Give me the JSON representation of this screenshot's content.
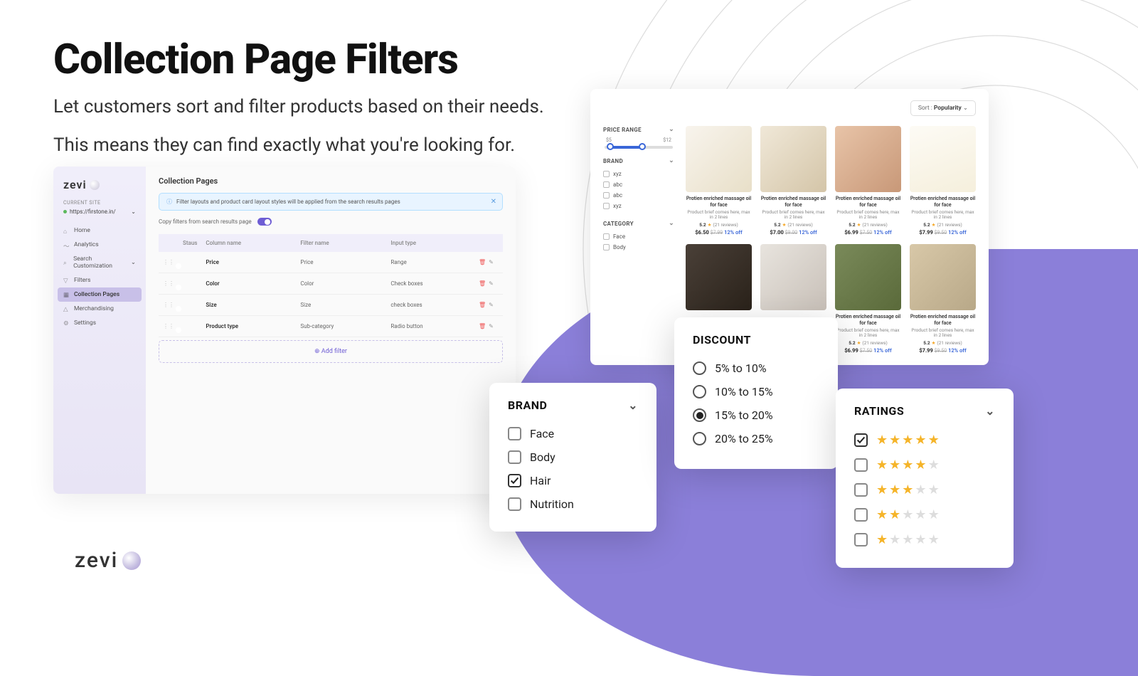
{
  "hero": {
    "title": "Collection Page Filters",
    "line1": "Let customers sort and filter products based on their needs.",
    "line2": "This means they can find exactly what you're looking for."
  },
  "admin": {
    "logo": "zevi",
    "site_label": "CURRENT SITE",
    "site_url": "https://firstone.in/",
    "nav": {
      "home": "Home",
      "analytics": "Analytics",
      "search": "Search Customization",
      "filters": "Filters",
      "collection": "Collection Pages",
      "merch": "Merchandising",
      "settings": "Settings"
    },
    "page_title": "Collection Pages",
    "banner": "Filter layouts and product card layout styles will be applied from the search results pages",
    "copy_label": "Copy filters from search results page",
    "table": {
      "h1": "Staus",
      "h2": "Column name",
      "h3": "Filter name",
      "h4": "Input type",
      "rows": [
        {
          "col": "Price",
          "filter": "Price",
          "type": "Range"
        },
        {
          "col": "Color",
          "filter": "Color",
          "type": "Check boxes"
        },
        {
          "col": "Size",
          "filter": "Size",
          "type": "check boxes"
        },
        {
          "col": "Product type",
          "filter": "Sub-category",
          "type": "Radio button"
        }
      ]
    },
    "add_filter": "Add filter"
  },
  "storefront": {
    "sort_label": "Sort : ",
    "sort_value": "Popularity",
    "filters": {
      "price": {
        "title": "PRICE RANGE",
        "low": "$5",
        "high": "$12"
      },
      "brand": {
        "title": "BRAND",
        "opts": [
          "xyz",
          "abc",
          "abc",
          "xyz"
        ]
      },
      "category": {
        "title": "CATEGORY",
        "opts": [
          "Face",
          "Body"
        ]
      }
    },
    "product": {
      "name": "Protien enriched massage oil for face",
      "brief": "Product brief comes here, max in 2 lines",
      "rating": "5.2",
      "reviews": "(21 reviews)",
      "off": "12% off"
    },
    "prices": [
      "$6.50",
      "$7.00",
      "$6.99",
      "$7.99"
    ],
    "strikes": [
      "$7.99",
      "$9.00",
      "$7.50",
      "$9.50"
    ]
  },
  "popups": {
    "brand": {
      "title": "BRAND",
      "opts": [
        "Face",
        "Body",
        "Hair",
        "Nutrition"
      ],
      "selected": 2
    },
    "discount": {
      "title": "DISCOUNT",
      "opts": [
        "5% to 10%",
        "10% to 15%",
        "15% to 20%",
        "20% to 25%"
      ],
      "selected": 2
    },
    "ratings": {
      "title": "RATINGS"
    }
  },
  "footer_logo": "zevi"
}
